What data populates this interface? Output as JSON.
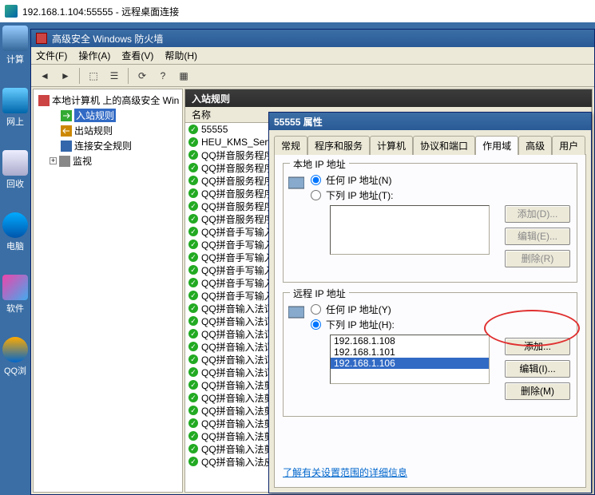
{
  "rdp": {
    "title": "192.168.1.104:55555 - 远程桌面连接"
  },
  "desktop": {
    "icons": [
      "计算",
      "网上",
      "回收",
      "电脑",
      "软件",
      "QQ浏"
    ]
  },
  "mmc": {
    "title": "高级安全 Windows 防火墙",
    "menu": {
      "file": "文件(F)",
      "action": "操作(A)",
      "view": "查看(V)",
      "help": "帮助(H)"
    },
    "tree": {
      "root": "本地计算机 上的高级安全 Win",
      "inbound": "入站规则",
      "outbound": "出站规则",
      "connsec": "连接安全规则",
      "monitor": "监视"
    },
    "list": {
      "header": "入站规则",
      "col_name": "名称",
      "rows": [
        "55555",
        "HEU_KMS_Service",
        "QQ拼音服务程序",
        "QQ拼音服务程序",
        "QQ拼音服务程序",
        "QQ拼音服务程序",
        "QQ拼音服务程序",
        "QQ拼音服务程序",
        "QQ拼音手写输入",
        "QQ拼音手写输入",
        "QQ拼音手写输入",
        "QQ拼音手写输入",
        "QQ拼音手写输入",
        "QQ拼音手写输入",
        "QQ拼音输入法词库",
        "QQ拼音输入法词库",
        "QQ拼音输入法词库",
        "QQ拼音输入法词库",
        "QQ拼音输入法词库",
        "QQ拼音输入法词库",
        "QQ拼音输入法剪贴",
        "QQ拼音输入法剪贴",
        "QQ拼音输入法剪贴",
        "QQ拼音输入法剪贴",
        "QQ拼音输入法剪贴",
        "QQ拼音输入法剪贴",
        "QQ拼音输入法皮肤"
      ]
    }
  },
  "dialog": {
    "title": "55555 属性",
    "tabs": {
      "general": "常规",
      "programs": "程序和服务",
      "computers": "计算机",
      "protocols": "协议和端口",
      "scope": "作用域",
      "advanced": "高级",
      "users": "用户"
    },
    "local": {
      "legend": "本地 IP 地址",
      "any": "任何 IP 地址(N)",
      "these": "下列 IP 地址(T):",
      "add": "添加(D)...",
      "edit": "编辑(E)...",
      "delete": "删除(R)"
    },
    "remote": {
      "legend": "远程 IP 地址",
      "any": "任何 IP 地址(Y)",
      "these": "下列 IP 地址(H):",
      "ips": [
        "192.168.1.108",
        "192.168.1.101",
        "192.168.1.106"
      ],
      "add": "添加...",
      "edit": "编辑(I)...",
      "delete": "删除(M)"
    },
    "link": "了解有关设置范围的详细信息"
  }
}
